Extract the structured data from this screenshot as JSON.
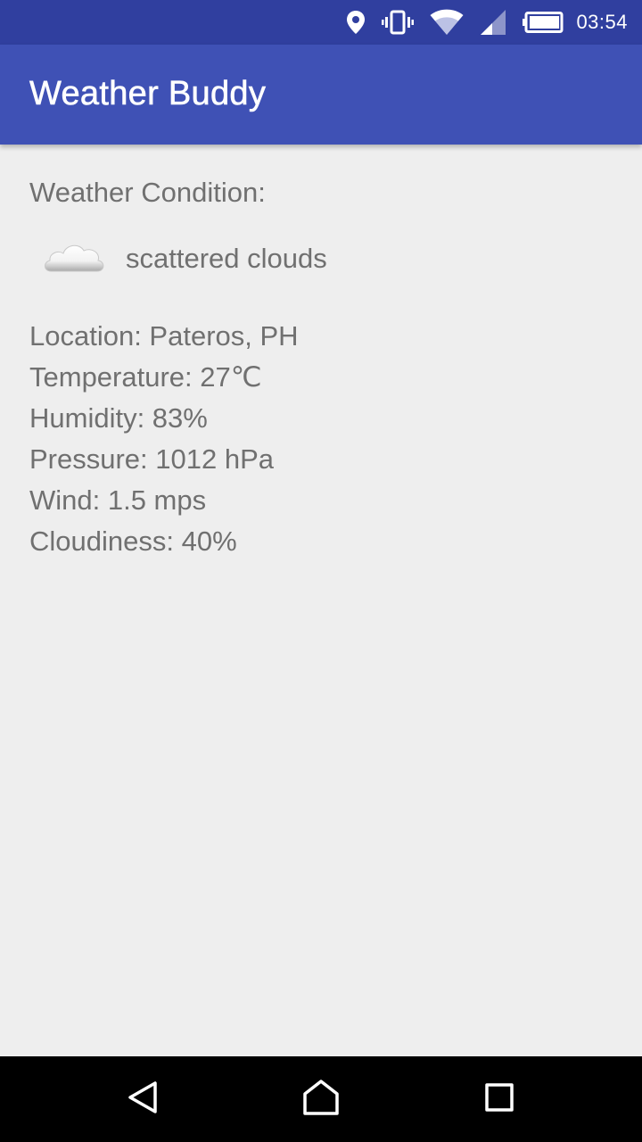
{
  "status_bar": {
    "time": "03:54",
    "icons": [
      "location-icon",
      "vibrate-icon",
      "wifi-icon",
      "cell-signal-icon",
      "battery-icon"
    ]
  },
  "app_bar": {
    "title": "Weather Buddy"
  },
  "weather": {
    "condition_label": "Weather Condition:",
    "condition_icon": "cloud-icon",
    "condition": "scattered clouds",
    "details": {
      "location": "Location: Pateros, PH",
      "temperature": "Temperature: 27℃",
      "humidity": "Humidity: 83%",
      "pressure": "Pressure: 1012 hPa",
      "wind": "Wind: 1.5 mps",
      "cloudiness": "Cloudiness: 40%"
    }
  },
  "nav_bar": {
    "buttons": [
      "back-icon",
      "home-icon",
      "recents-icon"
    ]
  },
  "colors": {
    "status_bar": "#303f9f",
    "app_bar": "#3f51b5",
    "background": "#eeeeee",
    "text": "#707070",
    "nav_bar": "#000000"
  }
}
